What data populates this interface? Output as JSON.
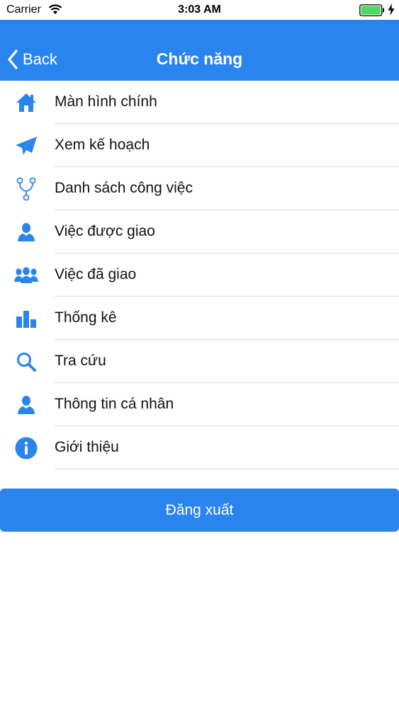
{
  "status_bar": {
    "carrier": "Carrier",
    "time": "3:03 AM"
  },
  "nav": {
    "back_label": "Back",
    "title": "Chức năng"
  },
  "menu": [
    {
      "label": "Màn hình chính",
      "icon": "home-icon"
    },
    {
      "label": "Xem kế hoạch",
      "icon": "paper-plane-icon"
    },
    {
      "label": "Danh sách công việc",
      "icon": "fork-icon"
    },
    {
      "label": "Việc được giao",
      "icon": "user-icon"
    },
    {
      "label": "Việc đã giao",
      "icon": "users-icon"
    },
    {
      "label": "Thống kê",
      "icon": "bar-chart-icon"
    },
    {
      "label": "Tra cứu",
      "icon": "search-icon"
    },
    {
      "label": "Thông tin cá nhân",
      "icon": "user-icon"
    },
    {
      "label": "Giới thiệu",
      "icon": "info-icon"
    }
  ],
  "logout_label": "Đăng xuất",
  "colors": {
    "accent": "#2a84ee",
    "separator": "#dcdcdc",
    "battery": "#4cd964"
  }
}
